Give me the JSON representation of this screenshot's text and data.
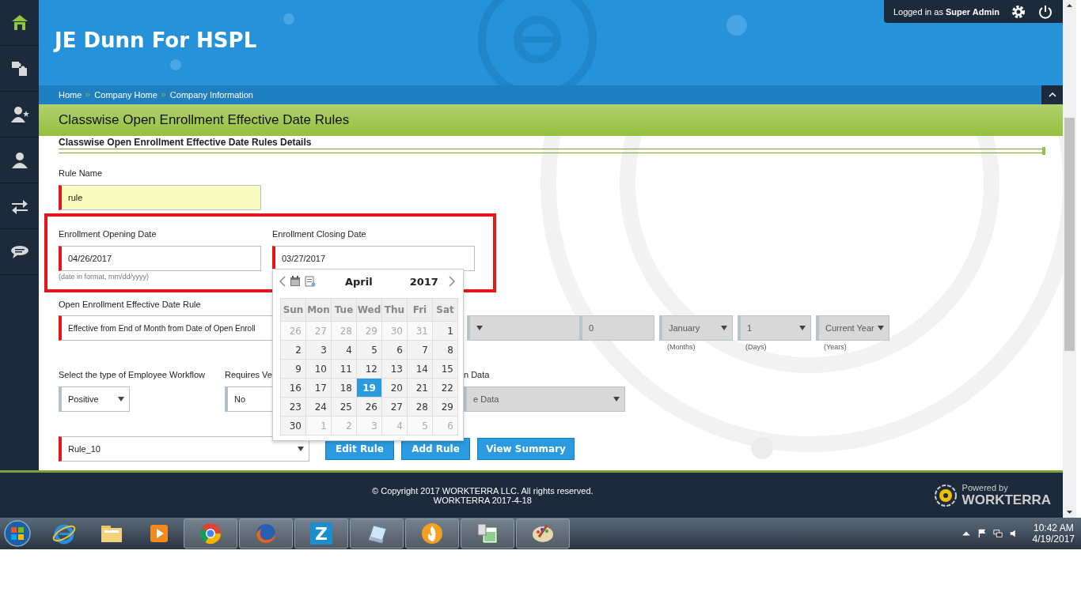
{
  "sidebar": {
    "items": [
      {
        "kind": "home",
        "selected": true
      },
      {
        "kind": "puzzle",
        "selected": false
      },
      {
        "kind": "user-star",
        "selected": false
      },
      {
        "kind": "user",
        "selected": false
      },
      {
        "kind": "arrows",
        "selected": false
      },
      {
        "kind": "chat",
        "selected": false
      }
    ]
  },
  "header": {
    "title": "JE Dunn For HSPL",
    "login": "Logged in as **Super Admin**"
  },
  "breadcrumb": [
    "Home",
    "Company Home",
    "Company Information"
  ],
  "page_title": "Classwise Open Enrollment Effective Date Rules",
  "section_title": "Classwise Open Enrollment Effective Date Rules Details",
  "rule_name": {
    "label": "Rule Name",
    "value": "rule",
    "required": true,
    "focused": true
  },
  "opening_date": {
    "label": "Enrollment Opening Date",
    "value": "04/26/2017",
    "required": true,
    "hint": "(date in format, mm/dd/yyyy)"
  },
  "closing_date": {
    "label": "Enrollment Closing Date",
    "value": "03/27/2017",
    "required": true
  },
  "effective_rule": {
    "label": "Open Enrollment Effective Date Rule",
    "value": "Effective from End of Month from Date of Open Enroll",
    "required": true,
    "parts": [
      {
        "kind": "select"
      },
      {
        "kind": "input",
        "value": "0"
      },
      {
        "kind": "select",
        "value": "January",
        "unit": "(Months)"
      },
      {
        "kind": "select",
        "value": "1",
        "unit": "(Days)"
      },
      {
        "kind": "select",
        "value": "Current Year",
        "unit": "(Years)"
      }
    ]
  },
  "workflow": {
    "label": "Select the type of Employee Workflow",
    "value": "Positive",
    "disabled": false
  },
  "requires": {
    "label": "Requires Ve",
    "value": "No",
    "disabled": false
  },
  "data_field": {
    "label": "n Data",
    "value": "e Data",
    "disabled": true
  },
  "rule_select": {
    "value": "Rule_10",
    "required": true
  },
  "buttons": [
    "Edit Rule",
    "Add Rule",
    "View Summary"
  ],
  "calendar": {
    "month": "April",
    "year": "2017",
    "weekdays": [
      "Sun",
      "Mon",
      "Tue",
      "Wed",
      "Thu",
      "Fri",
      "Sat"
    ],
    "weeks": [
      [
        {
          "day": "26",
          "other": true,
          "selected": false
        },
        {
          "day": "27",
          "other": true,
          "selected": false
        },
        {
          "day": "28",
          "other": true,
          "selected": false
        },
        {
          "day": "29",
          "other": true,
          "selected": false
        },
        {
          "day": "30",
          "other": true,
          "selected": false
        },
        {
          "day": "31",
          "other": true,
          "selected": false
        },
        {
          "day": "1",
          "other": false,
          "selected": false
        }
      ],
      [
        {
          "day": "2",
          "other": false,
          "selected": false
        },
        {
          "day": "3",
          "other": false,
          "selected": false
        },
        {
          "day": "4",
          "other": false,
          "selected": false
        },
        {
          "day": "5",
          "other": false,
          "selected": false
        },
        {
          "day": "6",
          "other": false,
          "selected": false
        },
        {
          "day": "7",
          "other": false,
          "selected": false
        },
        {
          "day": "8",
          "other": false,
          "selected": false
        }
      ],
      [
        {
          "day": "9",
          "other": false,
          "selected": false
        },
        {
          "day": "10",
          "other": false,
          "selected": false
        },
        {
          "day": "11",
          "other": false,
          "selected": false
        },
        {
          "day": "12",
          "other": false,
          "selected": false
        },
        {
          "day": "13",
          "other": false,
          "selected": false
        },
        {
          "day": "14",
          "other": false,
          "selected": false
        },
        {
          "day": "15",
          "other": false,
          "selected": false
        }
      ],
      [
        {
          "day": "16",
          "other": false,
          "selected": false
        },
        {
          "day": "17",
          "other": false,
          "selected": false
        },
        {
          "day": "18",
          "other": false,
          "selected": false
        },
        {
          "day": "19",
          "other": false,
          "selected": true
        },
        {
          "day": "20",
          "other": false,
          "selected": false
        },
        {
          "day": "21",
          "other": false,
          "selected": false
        },
        {
          "day": "22",
          "other": false,
          "selected": false
        }
      ],
      [
        {
          "day": "23",
          "other": false,
          "selected": false
        },
        {
          "day": "24",
          "other": false,
          "selected": false
        },
        {
          "day": "25",
          "other": false,
          "selected": false
        },
        {
          "day": "26",
          "other": false,
          "selected": false
        },
        {
          "day": "27",
          "other": false,
          "selected": false
        },
        {
          "day": "28",
          "other": false,
          "selected": false
        },
        {
          "day": "29",
          "other": false,
          "selected": false
        }
      ],
      [
        {
          "day": "30",
          "other": false,
          "selected": false
        },
        {
          "day": "1",
          "other": true,
          "selected": false
        },
        {
          "day": "2",
          "other": true,
          "selected": false
        },
        {
          "day": "3",
          "other": true,
          "selected": false
        },
        {
          "day": "4",
          "other": true,
          "selected": false
        },
        {
          "day": "5",
          "other": true,
          "selected": false
        },
        {
          "day": "6",
          "other": true,
          "selected": false
        }
      ]
    ]
  },
  "footer": {
    "copyright": "© Copyright 2017 WORKTERRA LLC. All rights reserved.",
    "version": "WORKTERRA 2017-4-18",
    "powered_by": "Powered by",
    "brand": "WORKTERRA"
  },
  "taskbar": {
    "items": [
      {
        "kind": "ie",
        "running": false
      },
      {
        "kind": "folder",
        "running": false
      },
      {
        "kind": "media",
        "running": false
      },
      {
        "kind": "chrome",
        "running": true
      },
      {
        "kind": "firefox",
        "running": true
      },
      {
        "kind": "z",
        "label": "Z",
        "running": true
      },
      {
        "kind": "notepad",
        "running": true
      },
      {
        "kind": "flame",
        "running": true
      },
      {
        "kind": "sheet",
        "running": true
      },
      {
        "kind": "paint",
        "running": true
      }
    ],
    "time": "10:42 AM",
    "date": "4/19/2017"
  }
}
